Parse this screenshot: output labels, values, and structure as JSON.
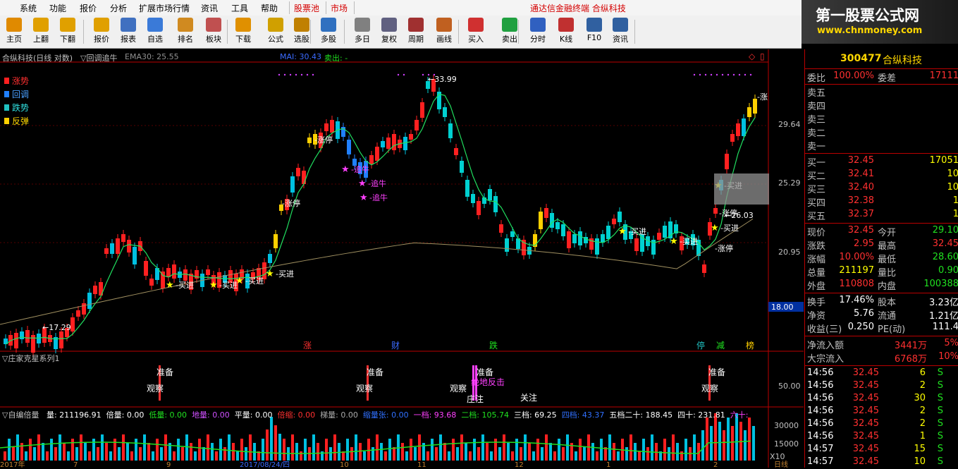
{
  "menu": {
    "items": [
      "系统",
      "功能",
      "报价",
      "分析",
      "扩展市场行情",
      "资讯",
      "工具",
      "帮助"
    ],
    "tabs": [
      "股票池",
      "市场"
    ],
    "title": "通达信金融终端 合纵科技"
  },
  "logo": {
    "line1": "第一股票公式网",
    "line2": "www.chnmoney.com"
  },
  "toolbar": [
    {
      "label": "主页",
      "icon": "home-icon",
      "color": "#e08a00"
    },
    {
      "label": "上翻",
      "icon": "arrow-up-icon",
      "color": "#e0a000"
    },
    {
      "label": "下翻",
      "icon": "arrow-down-icon",
      "color": "#e0a000"
    },
    {
      "label": "报价",
      "icon": "yen-icon",
      "color": "#e0a000"
    },
    {
      "label": "报表",
      "icon": "report-icon",
      "color": "#4070c0"
    },
    {
      "label": "自选",
      "icon": "f6-icon",
      "color": "#3a7ad8"
    },
    {
      "label": "排名",
      "icon": "rank-icon",
      "color": "#d08a20"
    },
    {
      "label": "板块",
      "icon": "grid-icon",
      "color": "#c05050"
    },
    {
      "label": "下载",
      "icon": "download-icon",
      "color": "#e09000"
    },
    {
      "label": "公式",
      "icon": "formula-icon",
      "color": "#d0a000"
    },
    {
      "label": "选股",
      "icon": "select-icon",
      "color": "#c08000"
    },
    {
      "label": "多股",
      "icon": "multi-icon",
      "color": "#3070c0"
    },
    {
      "label": "多日",
      "icon": "clock-icon",
      "color": "#808080"
    },
    {
      "label": "复权",
      "icon": "restore-icon",
      "color": "#606080"
    },
    {
      "label": "周期",
      "icon": "f8-icon",
      "color": "#a03030"
    },
    {
      "label": "画线",
      "icon": "draw-icon",
      "color": "#c06020"
    },
    {
      "label": "买入",
      "icon": "buy-icon",
      "color": "#d03030"
    },
    {
      "label": "卖出",
      "icon": "sell-icon",
      "color": "#20a040"
    },
    {
      "label": "分时",
      "icon": "minute-icon",
      "color": "#3060c0"
    },
    {
      "label": "K线",
      "icon": "kline-icon",
      "color": "#c03030"
    },
    {
      "label": "F10",
      "icon": "f10-icon",
      "color": "#3060a0"
    },
    {
      "label": "资讯",
      "icon": "news-icon",
      "color": "#3060a0"
    }
  ],
  "main_header": {
    "stock": "合纵科技(日线 对数)",
    "indicator": "▽回调追牛",
    "ema": "EMA30: 25.55",
    "mai": "MAI: 30.43",
    "sell": "卖出: -"
  },
  "legend": [
    {
      "label": "涨势",
      "color": "#ff3030",
      "box": "#ff2020"
    },
    {
      "label": "回调",
      "color": "#4aa0ff",
      "box": "#2080ff"
    },
    {
      "label": "跌势",
      "color": "#30e0e0",
      "box": "#20c0c0"
    },
    {
      "label": "反弹",
      "color": "#ffd700",
      "box": "#ffd000"
    }
  ],
  "price_axis": [
    "29.64",
    "25.29",
    "20.95",
    "18.00"
  ],
  "annotations": {
    "high": "33.99",
    "low": "17.29",
    "level": "26.03",
    "buy": "买进",
    "limit": "涨停",
    "chase": "追牛",
    "up": "涨"
  },
  "markers": [
    "涨",
    "财",
    "跌",
    "停",
    "减",
    "榜"
  ],
  "panel2": {
    "title": "▽庄家克星系列1",
    "axis": "50.00",
    "labels": [
      "准备",
      "观察",
      "准备",
      "观察",
      "观察",
      "准备",
      "绝地反击",
      "庄注",
      "关注",
      "准备",
      "观察"
    ]
  },
  "panel3": {
    "title": "▽自编倍量",
    "values": [
      {
        "t": "量: 211196.91",
        "c": "#ffffff"
      },
      {
        "t": "倍量: 0.00",
        "c": "#ffffff"
      },
      {
        "t": "低量: 0.00",
        "c": "#20e020"
      },
      {
        "t": "地量: 0.00",
        "c": "#d050ff"
      },
      {
        "t": "平量: 0.00",
        "c": "#ffffff"
      },
      {
        "t": "倍缩: 0.00",
        "c": "#ff3030"
      },
      {
        "t": "梯量: 0.00",
        "c": "#aaaaaa"
      },
      {
        "t": "缩量张: 0.00",
        "c": "#3070ff"
      },
      {
        "t": "一档: 93.68",
        "c": "#ff40ff"
      },
      {
        "t": "二档: 105.74",
        "c": "#20e020"
      },
      {
        "t": "三档: 69.25",
        "c": "#ffffff"
      },
      {
        "t": "四档: 43.37",
        "c": "#3070ff"
      },
      {
        "t": "五档二十: 188.45",
        "c": "#ffffff"
      },
      {
        "t": "四十: 231.81",
        "c": "#ffffff"
      },
      {
        "t": "六十:",
        "c": "#ff40ff"
      }
    ],
    "axis": [
      "30000",
      "15000",
      "X10"
    ]
  },
  "quote": {
    "code": "300477",
    "name": "合纵科技",
    "wb_label": "委比",
    "wb": "100.00%",
    "wc_label": "委差",
    "wc": "17111",
    "sells": [
      "卖五",
      "卖四",
      "卖三",
      "卖二",
      "卖一"
    ],
    "buys": [
      {
        "l": "买一",
        "p": "32.45",
        "v": "17051"
      },
      {
        "l": "买二",
        "p": "32.41",
        "v": "10"
      },
      {
        "l": "买三",
        "p": "32.40",
        "v": "10"
      },
      {
        "l": "买四",
        "p": "32.38",
        "v": "1"
      },
      {
        "l": "买五",
        "p": "32.37",
        "v": "1"
      }
    ],
    "stats": [
      {
        "l": "现价",
        "v": "32.45",
        "vc": "#ff3030",
        "l2": "今开",
        "v2": "29.10",
        "v2c": "#20e020"
      },
      {
        "l": "涨跌",
        "v": "2.95",
        "vc": "#ff3030",
        "l2": "最高",
        "v2": "32.45",
        "v2c": "#ff3030"
      },
      {
        "l": "涨幅",
        "v": "10.00%",
        "vc": "#ff3030",
        "l2": "最低",
        "v2": "28.60",
        "v2c": "#20e020"
      },
      {
        "l": "总量",
        "v": "211197",
        "vc": "#ffff00",
        "l2": "量比",
        "v2": "0.90",
        "v2c": "#20e020"
      },
      {
        "l": "外盘",
        "v": "110808",
        "vc": "#ff3030",
        "l2": "内盘",
        "v2": "100388",
        "v2c": "#20e020"
      }
    ],
    "stats2": [
      {
        "l": "换手",
        "v": "17.46%",
        "vc": "#ffffff",
        "l2": "股本",
        "v2": "3.23亿",
        "v2c": "#ffffff"
      },
      {
        "l": "净资",
        "v": "5.76",
        "vc": "#ffffff",
        "l2": "流通",
        "v2": "1.21亿",
        "v2c": "#ffffff"
      },
      {
        "l": "收益(三)",
        "v": "0.250",
        "vc": "#ffffff",
        "l2": "PE(动)",
        "v2": "111.4",
        "v2c": "#ffffff"
      }
    ],
    "flow": [
      {
        "l": "净流入额",
        "v": "3441万",
        "p": "5%"
      },
      {
        "l": "大宗流入",
        "v": "6768万",
        "p": "10%"
      }
    ],
    "ticks": [
      {
        "t": "14:56",
        "p": "32.45",
        "v": "6",
        "s": "S"
      },
      {
        "t": "14:56",
        "p": "32.45",
        "v": "2",
        "s": "S"
      },
      {
        "t": "14:56",
        "p": "32.45",
        "v": "30",
        "s": "S"
      },
      {
        "t": "14:56",
        "p": "32.45",
        "v": "2",
        "s": "S"
      },
      {
        "t": "14:56",
        "p": "32.45",
        "v": "2",
        "s": "S"
      },
      {
        "t": "14:56",
        "p": "32.45",
        "v": "1",
        "s": "S"
      },
      {
        "t": "14:57",
        "p": "32.45",
        "v": "15",
        "s": "S"
      },
      {
        "t": "14:57",
        "p": "32.45",
        "v": "10",
        "s": "S"
      }
    ]
  },
  "date_axis": [
    "2017年",
    "7",
    "9",
    "2017/08/24/四",
    "10",
    "11",
    "12",
    "1",
    "2",
    "日线"
  ]
}
